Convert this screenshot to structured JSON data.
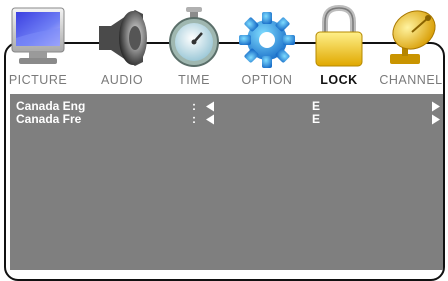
{
  "tabs": [
    {
      "label": "PICTURE",
      "icon": "monitor-icon",
      "active": false
    },
    {
      "label": "AUDIO",
      "icon": "speaker-icon",
      "active": false
    },
    {
      "label": "TIME",
      "icon": "stopwatch-icon",
      "active": false
    },
    {
      "label": "OPTION",
      "icon": "gear-icon",
      "active": false
    },
    {
      "label": "LOCK",
      "icon": "padlock-icon",
      "active": true
    },
    {
      "label": "CHANNEL",
      "icon": "satellite-dish-icon",
      "active": false
    }
  ],
  "rows": [
    {
      "name": "Canada Eng",
      "colon": ":",
      "value": "E"
    },
    {
      "name": "Canada Fre",
      "colon": ":",
      "value": "E"
    }
  ],
  "colors": {
    "panel": "#7f7f7f",
    "active_label": "#111111",
    "inactive_label": "#7a7a7a"
  }
}
